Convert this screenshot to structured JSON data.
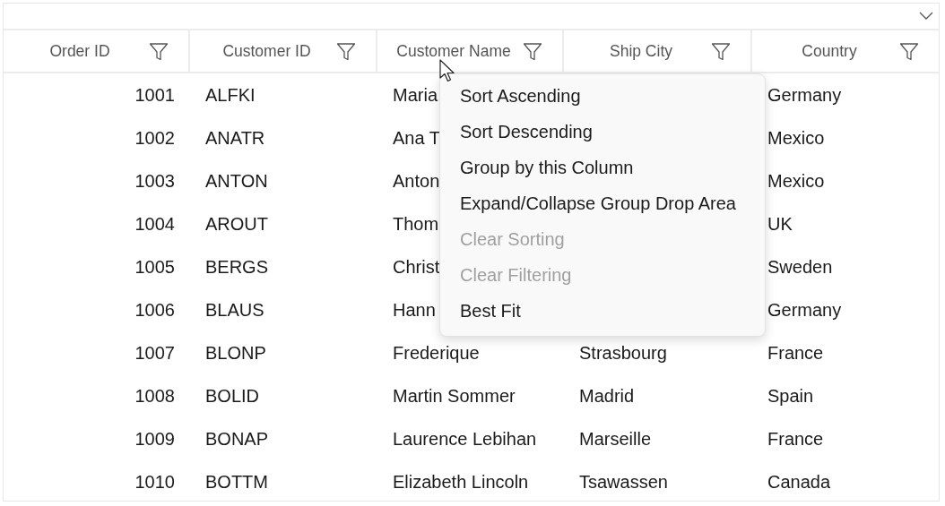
{
  "table": {
    "columns": [
      {
        "label": "Order ID"
      },
      {
        "label": "Customer ID"
      },
      {
        "label": "Customer Name"
      },
      {
        "label": "Ship City"
      },
      {
        "label": "Country"
      }
    ],
    "rows": [
      [
        "1001",
        "ALFKI",
        "Maria",
        "",
        "Germany"
      ],
      [
        "1002",
        "ANATR",
        "Ana T",
        "",
        "Mexico"
      ],
      [
        "1003",
        "ANTON",
        "Anton",
        "",
        "Mexico"
      ],
      [
        "1004",
        "AROUT",
        "Thom",
        "",
        "UK"
      ],
      [
        "1005",
        "BERGS",
        "Christ",
        "",
        "Sweden"
      ],
      [
        "1006",
        "BLAUS",
        "Hann",
        "",
        "Germany"
      ],
      [
        "1007",
        "BLONP",
        "Frederique",
        "Strasbourg",
        "France"
      ],
      [
        "1008",
        "BOLID",
        "Martin Sommer",
        "Madrid",
        "Spain"
      ],
      [
        "1009",
        "BONAP",
        "Laurence Lebihan",
        "Marseille",
        "France"
      ],
      [
        "1010",
        "BOTTM",
        "Elizabeth Lincoln",
        "Tsawassen",
        "Canada"
      ]
    ]
  },
  "context_menu": {
    "items": [
      {
        "label": "Sort Ascending",
        "disabled": false
      },
      {
        "label": "Sort Descending",
        "disabled": false
      },
      {
        "label": "Group by this Column",
        "disabled": false
      },
      {
        "label": "Expand/Collapse Group Drop Area",
        "disabled": false
      },
      {
        "label": "Clear Sorting",
        "disabled": true
      },
      {
        "label": "Clear Filtering",
        "disabled": true
      },
      {
        "label": "Best Fit",
        "disabled": false
      }
    ]
  }
}
